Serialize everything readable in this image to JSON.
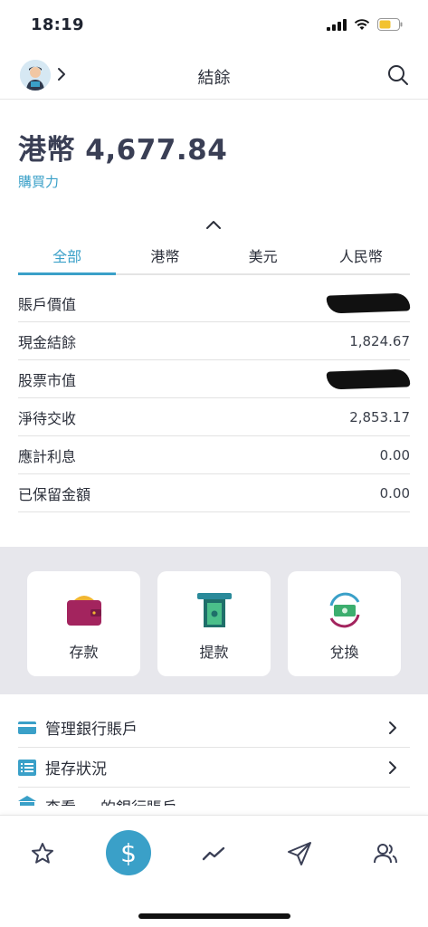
{
  "status_bar": {
    "time": "18:19"
  },
  "nav": {
    "title": "結餘"
  },
  "account": {
    "balance": "港幣 4,677.84",
    "buying_power": "購買力"
  },
  "tabs": [
    {
      "label": "全部",
      "active": true
    },
    {
      "label": "港幣",
      "active": false
    },
    {
      "label": "美元",
      "active": false
    },
    {
      "label": "人民幣",
      "active": false
    }
  ],
  "rows": [
    {
      "label": "賬戶價值",
      "value": "",
      "redacted": true
    },
    {
      "label": "現金結餘",
      "value": "1,824.67",
      "redacted": false
    },
    {
      "label": "股票市值",
      "value": "",
      "redacted": true
    },
    {
      "label": "淨待交收",
      "value": "2,853.17",
      "redacted": false
    },
    {
      "label": "應計利息",
      "value": "0.00",
      "redacted": false
    },
    {
      "label": "已保留金額",
      "value": "0.00",
      "redacted": false
    }
  ],
  "actions": [
    {
      "label": "存款",
      "icon": "wallet-icon"
    },
    {
      "label": "提款",
      "icon": "atm-withdraw-icon"
    },
    {
      "label": "兌換",
      "icon": "currency-exchange-icon"
    }
  ],
  "links": [
    {
      "label": "管理銀行賬戶",
      "icon": "card-icon"
    },
    {
      "label": "提存狀況",
      "icon": "list-icon"
    },
    {
      "label": "查看 ... 的銀行賬戶",
      "icon": "bank-icon"
    }
  ],
  "tab_bar": {
    "items": [
      {
        "name": "watchlist",
        "icon": "star-icon"
      },
      {
        "name": "balance",
        "icon": "dollar-icon",
        "symbol": "$",
        "active": true
      },
      {
        "name": "markets",
        "icon": "trend-icon"
      },
      {
        "name": "trade",
        "icon": "send-icon"
      },
      {
        "name": "community",
        "icon": "users-icon"
      }
    ]
  },
  "colors": {
    "accent": "#3aa0c8",
    "text": "#2b2f3a",
    "panel": "#e7e7ec"
  }
}
